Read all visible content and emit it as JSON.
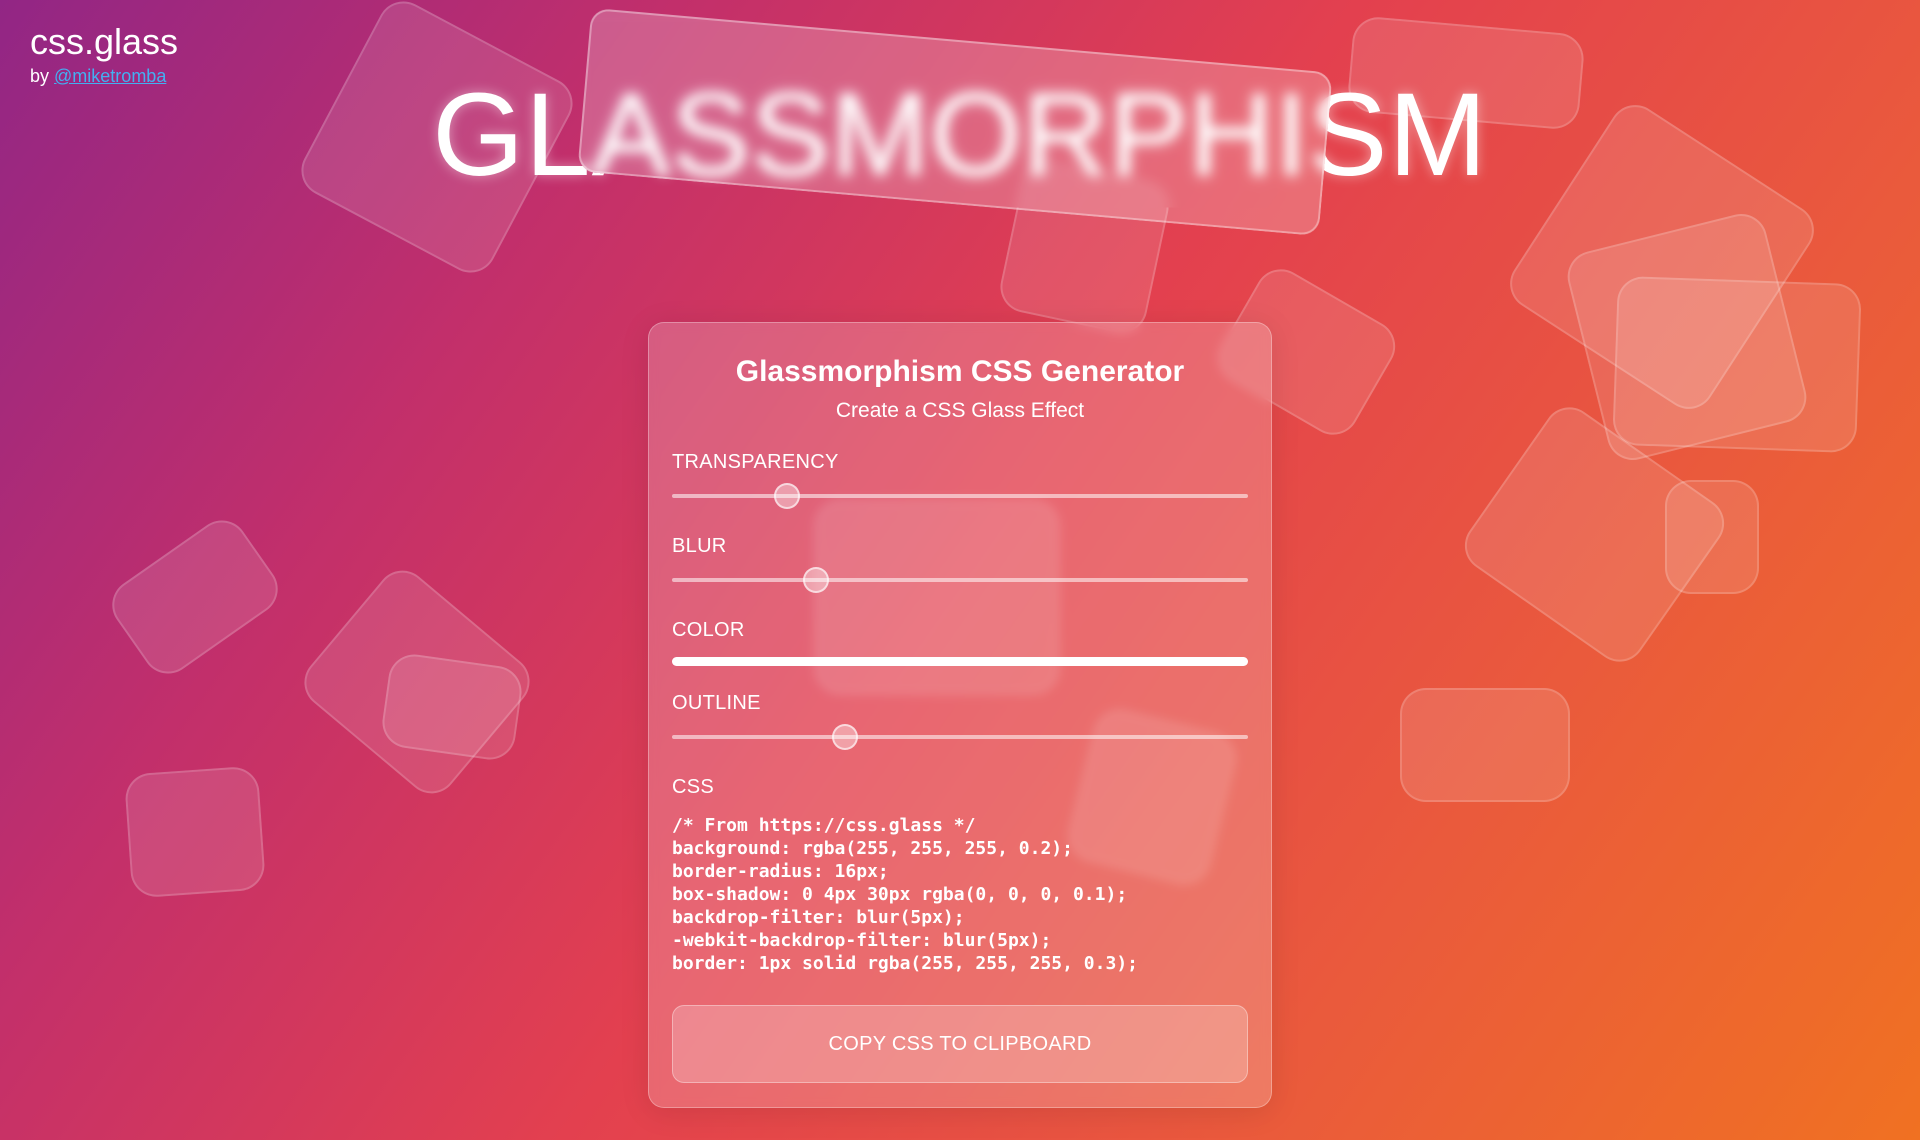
{
  "brand": {
    "title": "css.glass",
    "by_label": "by",
    "author_link": "@miketromba"
  },
  "hero": {
    "title": "GLASSMORPHISM"
  },
  "generator": {
    "title": "Glassmorphism CSS Generator",
    "subtitle": "Create a CSS Glass Effect",
    "controls": {
      "transparency": {
        "label": "TRANSPARENCY",
        "value_fraction": 0.2
      },
      "blur": {
        "label": "BLUR",
        "value_fraction": 0.25
      },
      "color": {
        "label": "COLOR",
        "value": "#ffffff"
      },
      "outline": {
        "label": "OUTLINE",
        "value_fraction": 0.3
      }
    },
    "css_label": "CSS",
    "css_code": "/* From https://css.glass */\nbackground: rgba(255, 255, 255, 0.2);\nborder-radius: 16px;\nbox-shadow: 0 4px 30px rgba(0, 0, 0, 0.1);\nbackdrop-filter: blur(5px);\n-webkit-backdrop-filter: blur(5px);\nborder: 1px solid rgba(255, 255, 255, 0.3);",
    "copy_button": "COPY CSS TO CLIPBOARD"
  },
  "colors": {
    "link": "#43b0f2",
    "gradient_start": "#922685",
    "gradient_end": "#f07122"
  }
}
